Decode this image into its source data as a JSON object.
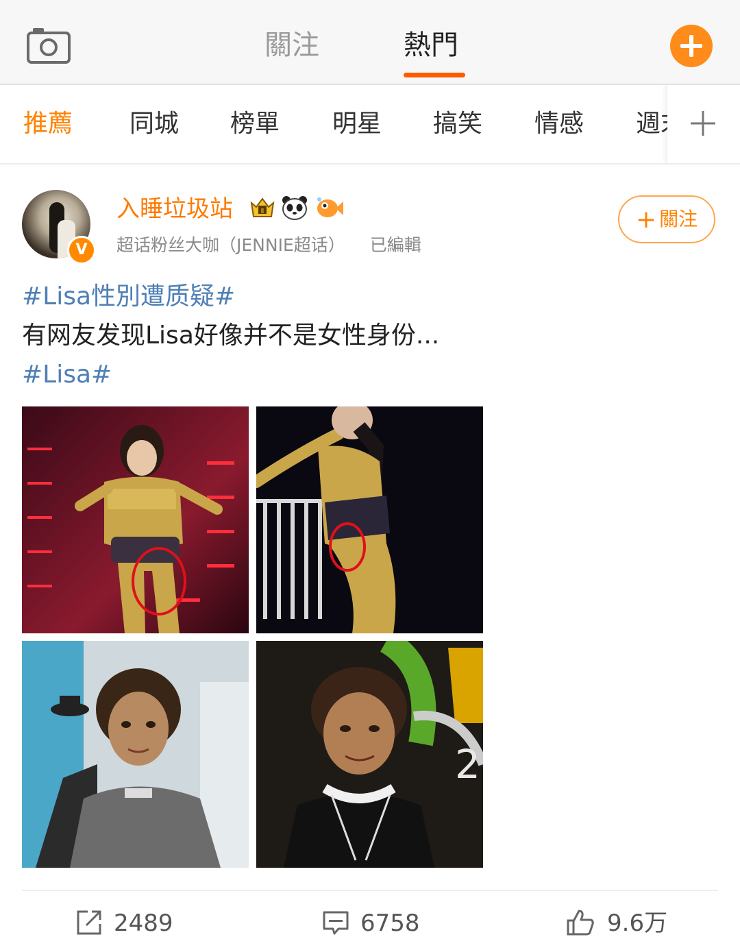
{
  "header": {
    "tabs": [
      {
        "label": "關注",
        "active": false
      },
      {
        "label": "熱門",
        "active": true
      }
    ],
    "icons": {
      "camera": "camera-icon",
      "compose": "plus-circle-icon"
    },
    "accent_color": "#ff5a00"
  },
  "categories": {
    "items": [
      "推薦",
      "同城",
      "榜單",
      "明星",
      "搞笑",
      "情感",
      "週末"
    ],
    "active_index": 0,
    "active_color": "#ff8200",
    "more_icon": "plus-icon"
  },
  "post": {
    "author": {
      "name": "入睡垃圾站",
      "verified_badge": "V",
      "badges": [
        "crown-level-badge",
        "panda-badge",
        "fish-badge"
      ],
      "subtitle": "超话粉丝大咖（JENNIE超话）",
      "edited": "已編輯"
    },
    "follow_button": {
      "label": "關注",
      "icon": "plus-icon"
    },
    "text": {
      "hashtag_1": "#Lisa性別遭质疑#",
      "body": "有网友发现Lisa好像并不是女性身份...",
      "hashtag_2": "#Lisa#"
    },
    "images": [
      "stage-performance-photo-1",
      "stage-performance-photo-2",
      "short-hair-portrait-photo",
      "event-portrait-photo"
    ],
    "stats": {
      "reposts": "2489",
      "comments": "6758",
      "likes": "9.6万"
    }
  }
}
